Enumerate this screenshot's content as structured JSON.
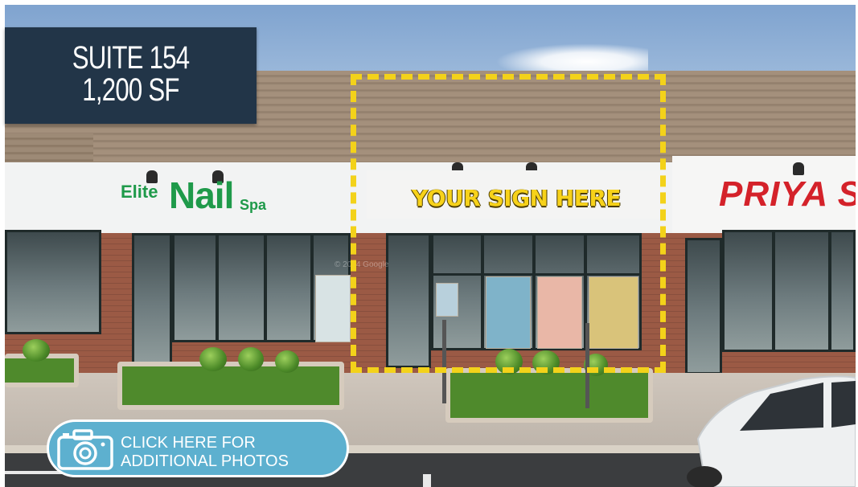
{
  "suite": {
    "number": "SUITE 154",
    "size": "1,200 SF"
  },
  "sign_placeholder": "YOUR SIGN HERE",
  "photos_button": {
    "line1": "CLICK HERE FOR",
    "line2": "ADDITIONAL PHOTOS",
    "icon": "camera-icon"
  },
  "storefront_signs": {
    "nail_small": "Elite",
    "nail_large": "Nail",
    "nail_suffix": "Spa",
    "right": "PRIYA S"
  },
  "colors": {
    "panel": "#223548",
    "button": "#5db0cf",
    "highlight": "#f3d21a",
    "sign_text": "#f7d21a"
  }
}
